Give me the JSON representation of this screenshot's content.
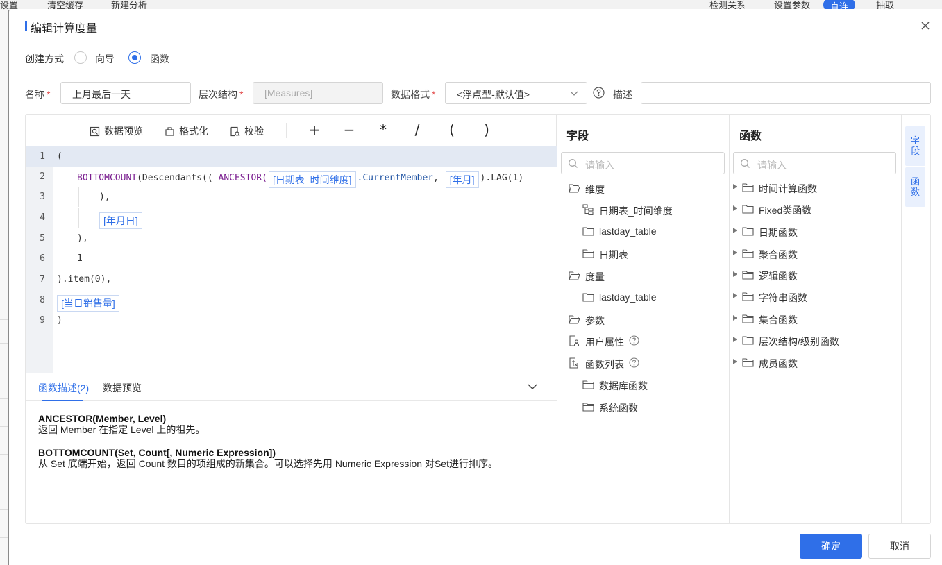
{
  "background": {
    "items": [
      "设置",
      "清空缓存",
      "新建分析",
      "检测关系",
      "设置参数",
      "直连",
      "抽取"
    ]
  },
  "dialog": {
    "title": "编辑计算度量",
    "create_mode_label": "创建方式",
    "create_mode_options": [
      "向导",
      "函数"
    ],
    "create_mode_selected": "函数",
    "name_label": "名称",
    "name_value": "上月最后一天",
    "hierarchy_label": "层次结构",
    "hierarchy_value": "[Measures]",
    "format_label": "数据格式",
    "format_value": "<浮点型-默认值>",
    "desc_label": "描述",
    "desc_value": "",
    "required_mark": "*"
  },
  "toolbar": {
    "preview": "数据预览",
    "format": "格式化",
    "validate": "校验",
    "operators": [
      "+",
      "−",
      "*",
      "/",
      "(",
      ")"
    ]
  },
  "code": {
    "line_numbers": [
      "1",
      "2",
      "3",
      "4",
      "5",
      "6",
      "7",
      "8",
      "9"
    ],
    "l1": "(",
    "l2_fn1": "BOTTOMCOUNT",
    "l2_mid": "(Descendants(( ",
    "l2_fn2": "ANCESTOR(",
    "l2_chip1": "[日期表_时间维度]",
    "l2_prop": ".CurrentMember",
    "l2_comma": ", ",
    "l2_chip2": "[年月]",
    "l2_tail": ").LAG(1)",
    "l3": "),",
    "l4_chip": "[年月日]",
    "l5": "),",
    "l6": "1",
    "l7": ").item(0),",
    "l8_chip": "[当日销售量]",
    "l9": ")"
  },
  "desc_panel": {
    "tab1": "函数描述(2)",
    "tab2": "数据预览",
    "fn1_sig": "ANCESTOR(Member, Level)",
    "fn1_desc": "返回 Member 在指定 Level 上的祖先。",
    "fn2_sig": "BOTTOMCOUNT(Set, Count[, Numeric Expression])",
    "fn2_desc": "从 Set 底端开始，返回 Count 数目的项组成的新集合。可以选择先用 Numeric Expression 对Set进行排序。"
  },
  "fields_panel": {
    "title": "字段",
    "search_placeholder": "请输入",
    "items": [
      "维度",
      "日期表_时间维度",
      "lastday_table",
      "日期表",
      "度量",
      "lastday_table",
      "参数",
      "用户属性",
      "函数列表",
      "数据库函数",
      "系统函数"
    ]
  },
  "funcs_panel": {
    "title": "函数",
    "search_placeholder": "请输入",
    "items": [
      "时间计算函数",
      "Fixed类函数",
      "日期函数",
      "聚合函数",
      "逻辑函数",
      "字符串函数",
      "集合函数",
      "层次结构/级别函数",
      "成员函数"
    ]
  },
  "side_tabs": [
    "字段",
    "函数"
  ],
  "buttons": {
    "ok": "确定",
    "cancel": "取消"
  },
  "colors": {
    "accent": "#2f6fe8",
    "required": "#e34d4d",
    "keyword": "#7a1d8f"
  }
}
